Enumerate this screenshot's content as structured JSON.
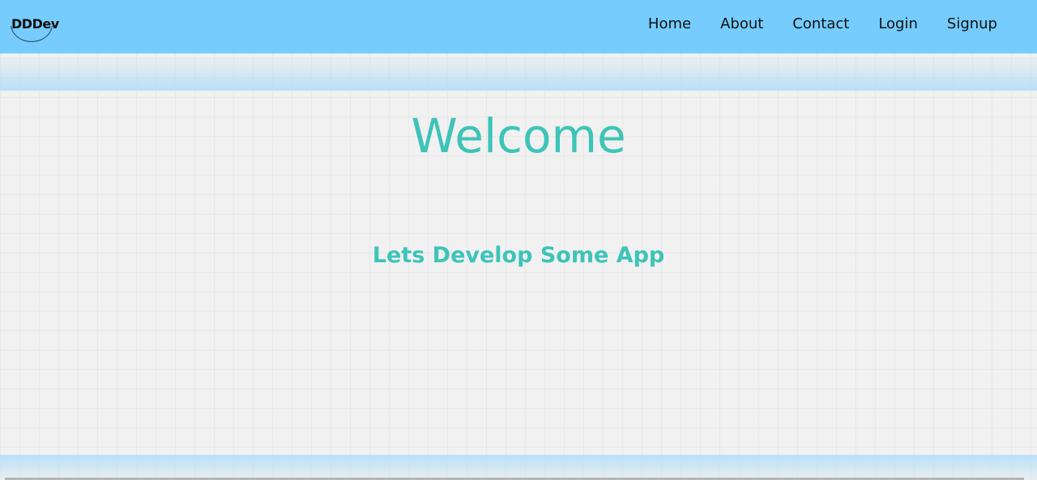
{
  "brand": {
    "logo_text": "DDDev"
  },
  "nav": {
    "items": [
      {
        "label": "Home"
      },
      {
        "label": "About"
      },
      {
        "label": "Contact"
      },
      {
        "label": "Login"
      },
      {
        "label": "Signup"
      }
    ]
  },
  "hero": {
    "title": "Welcome",
    "subtitle": "Lets Develop Some App"
  },
  "colors": {
    "navbar": "#76ccfd",
    "accent": "#3dc4b8",
    "background": "#f1f1f1"
  }
}
